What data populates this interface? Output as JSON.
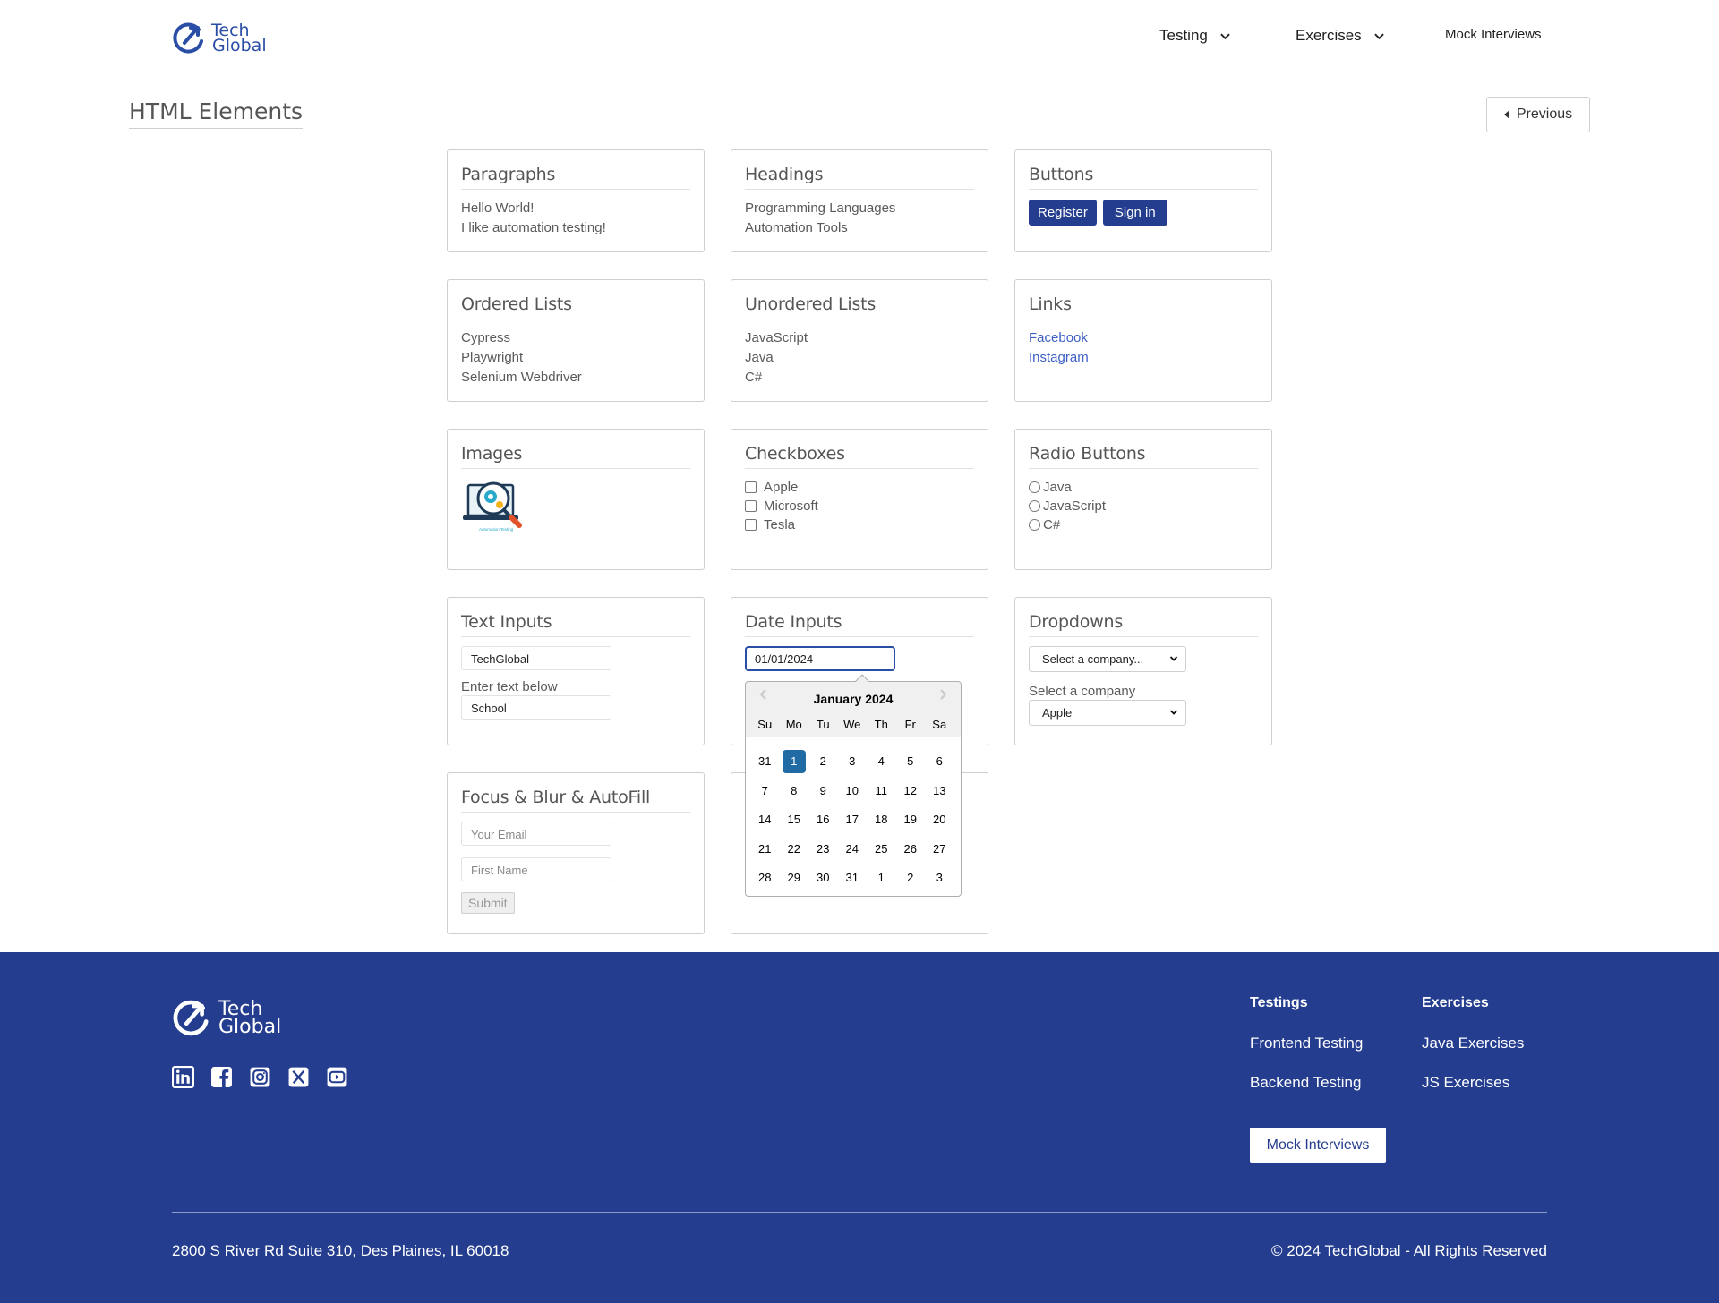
{
  "header": {
    "logo": {
      "line1": "Tech",
      "line2": "Global"
    },
    "nav": [
      {
        "label": "Testing",
        "has_dropdown": true
      },
      {
        "label": "Exercises",
        "has_dropdown": true
      },
      {
        "label": "Mock Interviews",
        "has_dropdown": false
      }
    ]
  },
  "page": {
    "title": "HTML Elements",
    "previous_label": "Previous"
  },
  "cards": {
    "paragraphs": {
      "title": "Paragraphs",
      "lines": [
        "Hello World!",
        "I like automation testing!"
      ]
    },
    "headings": {
      "title": "Headings",
      "lines": [
        "Programming Languages",
        "Automation Tools"
      ]
    },
    "buttons": {
      "title": "Buttons",
      "register": "Register",
      "signin": "Sign in"
    },
    "ordered_lists": {
      "title": "Ordered Lists",
      "items": [
        "Cypress",
        "Playwright",
        "Selenium Webdriver"
      ]
    },
    "unordered_lists": {
      "title": "Unordered Lists",
      "items": [
        "JavaScript",
        "Java",
        "C#"
      ]
    },
    "links": {
      "title": "Links",
      "items": [
        "Facebook",
        "Instagram"
      ]
    },
    "images": {
      "title": "Images",
      "image_caption": "Automation Testing"
    },
    "checkboxes": {
      "title": "Checkboxes",
      "items": [
        "Apple",
        "Microsoft",
        "Tesla"
      ]
    },
    "radio_buttons": {
      "title": "Radio Buttons",
      "items": [
        "Java",
        "JavaScript",
        "C#"
      ]
    },
    "text_inputs": {
      "title": "Text Inputs",
      "input1_value": "TechGlobal",
      "label": "Enter text below",
      "input2_value": "School"
    },
    "date_inputs": {
      "title": "Date Inputs",
      "value": "01/01/2024"
    },
    "dropdowns": {
      "title": "Dropdowns",
      "select1_value": "Select a company...",
      "label": "Select a company",
      "select2_value": "Apple"
    },
    "focus": {
      "title": "Focus & Blur & AutoFill",
      "email_placeholder": "Your Email",
      "name_placeholder": "First Name",
      "submit": "Submit"
    }
  },
  "calendar": {
    "month_label": "January 2024",
    "weekdays": [
      "Su",
      "Mo",
      "Tu",
      "We",
      "Th",
      "Fr",
      "Sa"
    ],
    "weeks": [
      [
        "31",
        "1",
        "2",
        "3",
        "4",
        "5",
        "6"
      ],
      [
        "7",
        "8",
        "9",
        "10",
        "11",
        "12",
        "13"
      ],
      [
        "14",
        "15",
        "16",
        "17",
        "18",
        "19",
        "20"
      ],
      [
        "21",
        "22",
        "23",
        "24",
        "25",
        "26",
        "27"
      ],
      [
        "28",
        "29",
        "30",
        "31",
        "1",
        "2",
        "3"
      ]
    ],
    "selected": "1"
  },
  "footer": {
    "logo": {
      "line1": "Tech",
      "line2": "Global"
    },
    "socials": [
      "linkedin-icon",
      "facebook-icon",
      "instagram-icon",
      "x-icon",
      "youtube-icon"
    ],
    "col1": {
      "head": "Testings",
      "items": [
        "Frontend Testing",
        "Backend Testing"
      ]
    },
    "col2": {
      "head": "Exercises",
      "items": [
        "Java Exercises",
        "JS Exercises"
      ]
    },
    "mock_button": "Mock Interviews",
    "address": "2800 S River Rd Suite 310, Des Plaines, IL 60018",
    "copyright": "© 2024 TechGlobal - All Rights Reserved"
  },
  "colors": {
    "brand_blue": "#243d8f",
    "logo_blue": "#2a4ea6",
    "link_blue": "#3d5fc4",
    "calendar_selected": "#216ba5"
  }
}
